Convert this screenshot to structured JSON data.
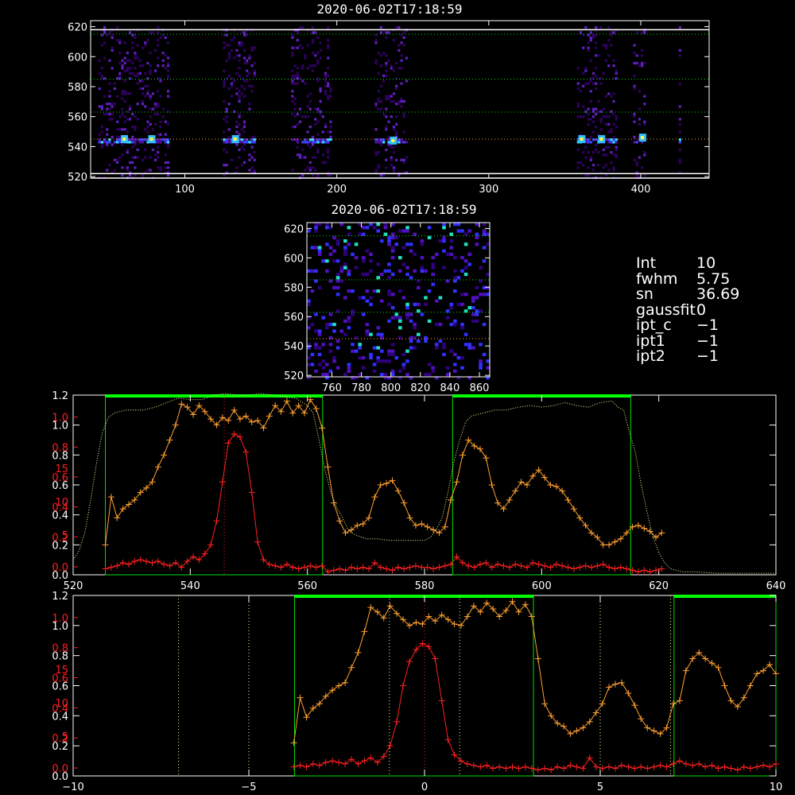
{
  "titles": {
    "top": "2020-06-02T17:18:59",
    "middle": "2020-06-02T17:18:59"
  },
  "fit_info": [
    {
      "key": "Int",
      "value": "10"
    },
    {
      "key": "fwhm",
      "value": "5.75"
    },
    {
      "key": "sn",
      "value": "36.69"
    },
    {
      "key": "gaussfit",
      "value": "0"
    },
    {
      "key": "ipt_c",
      "value": "−1"
    },
    {
      "key": "ipt1",
      "value": "−1"
    },
    {
      "key": "ipt2",
      "value": "−1"
    }
  ],
  "colors": {
    "background": "#000000",
    "orange": "#ffa030",
    "red": "#ff2020",
    "green": "#00e000",
    "window_bar": "#00ff00",
    "dotted": "#ffffa0"
  },
  "chart_data": [
    {
      "type": "heatmap",
      "title": "2020-06-02T17:18:59",
      "xlim": [
        38,
        445
      ],
      "ylim": [
        519,
        624
      ],
      "xticks": [
        "100",
        "200",
        "300",
        "400"
      ],
      "yticks": [
        "520",
        "540",
        "560",
        "580",
        "600",
        "620"
      ],
      "bright_columns": [
        [
          43,
          90
        ],
        [
          125,
          148
        ],
        [
          170,
          198
        ],
        [
          225,
          247
        ],
        [
          358,
          386
        ],
        [
          395,
          405
        ],
        [
          425,
          428
        ]
      ],
      "hot_row": 545,
      "hlines": [
        519,
        522,
        545,
        563,
        585,
        615,
        618
      ]
    },
    {
      "type": "heatmap",
      "title": "2020-06-02T17:18:59",
      "xlim": [
        743,
        867
      ],
      "ylim": [
        519,
        624
      ],
      "xticks": [
        "760",
        "780",
        "800",
        "820",
        "840",
        "860"
      ],
      "yticks": [
        "520",
        "540",
        "560",
        "580",
        "600",
        "620"
      ],
      "hlines": [
        545,
        563,
        585,
        615
      ]
    },
    {
      "type": "line",
      "xlim": [
        520,
        640
      ],
      "ylim": [
        0,
        1.2
      ],
      "xticks": [
        "520",
        "540",
        "560",
        "580",
        "600",
        "620",
        "640"
      ],
      "yticks_white": [
        "0.0",
        "0.2",
        "0.4",
        "0.6",
        "0.8",
        "1.0",
        "1.2"
      ],
      "yticks_red": [
        "0.0",
        "0.2",
        "0.4",
        "0.6",
        "0.8",
        "1.0",
        "1.2"
      ],
      "red_extra_ticks": [
        "5",
        "10",
        "15"
      ],
      "windows": [
        [
          525.5,
          562.6
        ],
        [
          584.8,
          615.2
        ]
      ],
      "center_line": 545.8,
      "series": [
        {
          "color": "orange",
          "x": [
            525.5,
            526.5,
            527.5,
            528.5,
            529.5,
            530.5,
            531.5,
            532.5,
            533.5,
            534.5,
            535.5,
            536.5,
            537.5,
            538.5,
            539.5,
            540.5,
            541.5,
            542.5,
            543.5,
            544.5,
            545.5,
            546.5,
            547.5,
            548.5,
            549.5,
            550.5,
            551.5,
            552.5,
            553.5,
            554.5,
            555.5,
            556.5,
            557.5,
            558.5,
            559.5,
            560.5,
            561.5,
            562.5,
            563.5,
            564.5,
            565.5,
            566.5,
            567.5,
            568.5,
            569.5,
            570.5,
            571.5,
            572.5,
            573.5,
            574.5,
            575.5,
            576.5,
            577.5,
            578.5,
            579.5,
            580.5,
            581.5,
            582.5,
            583.5,
            584.5,
            585.5,
            586.5,
            587.5,
            588.5,
            589.5,
            590.5,
            591.5,
            592.5,
            593.5,
            594.5,
            595.5,
            596.5,
            597.5,
            598.5,
            599.5,
            600.5,
            601.5,
            602.5,
            603.5,
            604.5,
            605.5,
            606.5,
            607.5,
            608.5,
            609.5,
            610.5,
            611.5,
            612.5,
            613.5,
            614.5,
            615.5,
            616.5,
            617.5,
            618.5,
            619.5,
            620.5
          ],
          "y": [
            0.2,
            0.52,
            0.38,
            0.44,
            0.47,
            0.5,
            0.55,
            0.58,
            0.62,
            0.72,
            0.8,
            0.9,
            1.0,
            1.14,
            1.12,
            1.07,
            1.13,
            1.09,
            1.04,
            1.0,
            1.05,
            1.03,
            1.1,
            1.04,
            1.06,
            1.02,
            1.03,
            0.98,
            1.06,
            1.13,
            1.09,
            1.16,
            1.08,
            1.13,
            1.08,
            1.17,
            1.11,
            0.98,
            0.72,
            0.48,
            0.36,
            0.28,
            0.3,
            0.33,
            0.34,
            0.38,
            0.52,
            0.6,
            0.61,
            0.63,
            0.56,
            0.48,
            0.38,
            0.33,
            0.34,
            0.32,
            0.3,
            0.28,
            0.32,
            0.5,
            0.62,
            0.8,
            0.9,
            0.86,
            0.84,
            0.78,
            0.6,
            0.48,
            0.44,
            0.5,
            0.56,
            0.62,
            0.6,
            0.66,
            0.7,
            0.65,
            0.6,
            0.59,
            0.56,
            0.5,
            0.44,
            0.38,
            0.33,
            0.28,
            0.25,
            0.2,
            0.2,
            0.22,
            0.24,
            0.28,
            0.32,
            0.33,
            0.31,
            0.29,
            0.25,
            0.28
          ]
        },
        {
          "color": "red",
          "x": [
            525.5,
            526.5,
            527.5,
            528.5,
            529.5,
            530.5,
            531.5,
            532.5,
            533.5,
            534.5,
            535.5,
            536.5,
            537.5,
            538.5,
            539.5,
            540.5,
            541.5,
            542.5,
            543.5,
            544.5,
            545.5,
            546.5,
            547.5,
            548.5,
            549.5,
            550.5,
            551.5,
            552.5,
            553.5,
            554.5,
            555.5,
            556.5,
            557.5,
            558.5,
            559.5,
            560.5,
            561.5,
            562.5,
            563.5,
            564.5,
            565.5,
            566.5,
            567.5,
            568.5,
            569.5,
            570.5,
            571.5,
            572.5,
            573.5,
            574.5,
            575.5,
            576.5,
            577.5,
            578.5,
            579.5,
            580.5,
            581.5,
            582.5,
            583.5,
            584.5,
            585.5,
            586.5,
            587.5,
            588.5,
            589.5,
            590.5,
            591.5,
            592.5,
            593.5,
            594.5,
            595.5,
            596.5,
            597.5,
            598.5,
            599.5,
            600.5,
            601.5,
            602.5,
            603.5,
            604.5,
            605.5,
            606.5,
            607.5,
            608.5,
            609.5,
            610.5,
            611.5,
            612.5,
            613.5,
            614.5,
            615.5,
            616.5,
            617.5,
            618.5,
            619.5,
            620.5
          ],
          "y": [
            0.04,
            0.05,
            0.06,
            0.08,
            0.07,
            0.09,
            0.1,
            0.09,
            0.08,
            0.09,
            0.07,
            0.06,
            0.08,
            0.05,
            0.09,
            0.12,
            0.1,
            0.14,
            0.2,
            0.36,
            0.62,
            0.88,
            0.94,
            0.92,
            0.82,
            0.55,
            0.22,
            0.1,
            0.07,
            0.06,
            0.05,
            0.07,
            0.05,
            0.04,
            0.05,
            0.06,
            0.05,
            0.06,
            0.02,
            0.03,
            0.04,
            0.03,
            0.05,
            0.04,
            0.05,
            0.04,
            0.08,
            0.05,
            0.04,
            0.03,
            0.05,
            0.04,
            0.05,
            0.06,
            0.05,
            0.05,
            0.04,
            0.05,
            0.06,
            0.07,
            0.12,
            0.08,
            0.06,
            0.05,
            0.07,
            0.08,
            0.05,
            0.07,
            0.06,
            0.05,
            0.07,
            0.06,
            0.05,
            0.08,
            0.07,
            0.06,
            0.05,
            0.07,
            0.06,
            0.05,
            0.04,
            0.05,
            0.06,
            0.05,
            0.06,
            0.07,
            0.05,
            0.04,
            0.05,
            0.04,
            0.03,
            0.02,
            0.03,
            0.02,
            0.03,
            0.04
          ]
        },
        {
          "color": "dotted",
          "x": [
            520,
            521,
            522,
            523,
            524,
            525,
            526,
            527,
            528,
            529,
            530,
            532,
            534,
            536,
            538,
            540,
            542,
            544,
            546,
            548,
            550,
            552,
            554,
            556,
            558,
            560,
            561,
            562,
            563,
            564,
            565,
            566,
            567,
            568,
            570,
            572,
            574,
            576,
            578,
            580,
            581,
            582,
            583,
            584,
            585,
            586,
            587,
            588,
            590,
            592,
            594,
            596,
            598,
            600,
            602,
            604,
            606,
            608,
            610,
            612,
            613,
            614,
            615,
            616,
            617,
            618,
            619,
            620,
            621,
            622,
            623,
            624,
            626,
            630,
            635,
            640
          ],
          "y": [
            0.1,
            0.16,
            0.28,
            0.5,
            0.75,
            0.95,
            1.05,
            1.08,
            1.09,
            1.1,
            1.1,
            1.1,
            1.12,
            1.15,
            1.18,
            1.17,
            1.17,
            1.2,
            1.21,
            1.2,
            1.2,
            1.21,
            1.2,
            1.19,
            1.18,
            1.13,
            1.08,
            0.9,
            0.7,
            0.55,
            0.45,
            0.38,
            0.3,
            0.27,
            0.24,
            0.24,
            0.23,
            0.23,
            0.23,
            0.23,
            0.25,
            0.3,
            0.38,
            0.55,
            0.75,
            0.9,
            1.02,
            1.06,
            1.08,
            1.1,
            1.1,
            1.12,
            1.13,
            1.12,
            1.13,
            1.15,
            1.13,
            1.12,
            1.15,
            1.16,
            1.12,
            1.1,
            0.95,
            0.82,
            0.6,
            0.42,
            0.25,
            0.15,
            0.08,
            0.04,
            0.03,
            0.02,
            0.02,
            0.01,
            0.01,
            0.01
          ]
        }
      ]
    },
    {
      "type": "line",
      "xlim": [
        -10,
        10
      ],
      "ylim": [
        0,
        1.2
      ],
      "xticks": [
        "−10",
        "−5",
        "0",
        "5",
        "10"
      ],
      "yticks_white": [
        "0.0",
        "0.2",
        "0.4",
        "0.6",
        "0.8",
        "1.0",
        "1.2"
      ],
      "yticks_red": [
        "0.0",
        "0.2",
        "0.4",
        "0.6",
        "0.8",
        "1.0",
        "1.2"
      ],
      "red_extra_ticks": [
        "5",
        "10",
        "15"
      ],
      "windows": [
        [
          -3.7,
          3.1
        ],
        [
          7.1,
          10.0
        ]
      ],
      "center_line": 0,
      "vlines": [
        -7,
        -5,
        -1,
        1,
        5,
        7
      ],
      "series": [
        {
          "color": "orange",
          "x": [
            -3.72,
            -3.54,
            -3.36,
            -3.17,
            -2.99,
            -2.81,
            -2.62,
            -2.44,
            -2.26,
            -2.08,
            -1.89,
            -1.71,
            -1.53,
            -1.34,
            -1.16,
            -0.98,
            -0.79,
            -0.61,
            -0.43,
            -0.24,
            -0.06,
            0.12,
            0.3,
            0.49,
            0.67,
            0.85,
            1.04,
            1.22,
            1.4,
            1.59,
            1.77,
            1.95,
            2.13,
            2.32,
            2.5,
            2.68,
            2.87,
            3.05,
            3.23,
            3.42,
            3.6,
            3.78,
            3.96,
            4.15,
            4.33,
            4.51,
            4.7,
            4.88,
            5.06,
            5.25,
            5.43,
            5.61,
            5.8,
            5.98,
            6.16,
            6.34,
            6.53,
            6.71,
            6.89,
            7.08,
            7.26,
            7.44,
            7.63,
            7.81,
            7.99,
            8.18,
            8.36,
            8.54,
            8.72,
            8.91,
            9.09,
            9.27,
            9.46,
            9.64,
            9.82,
            10.0
          ],
          "y": [
            0.22,
            0.52,
            0.39,
            0.45,
            0.48,
            0.53,
            0.57,
            0.6,
            0.62,
            0.72,
            0.82,
            0.96,
            1.12,
            1.09,
            1.05,
            1.13,
            1.08,
            1.04,
            1.0,
            1.02,
            1.01,
            1.06,
            1.03,
            1.07,
            1.04,
            1.01,
            1.0,
            1.06,
            1.13,
            1.09,
            1.15,
            1.11,
            1.06,
            1.1,
            1.16,
            1.09,
            1.14,
            1.06,
            0.78,
            0.48,
            0.4,
            0.35,
            0.33,
            0.28,
            0.3,
            0.32,
            0.36,
            0.42,
            0.48,
            0.59,
            0.61,
            0.62,
            0.55,
            0.47,
            0.38,
            0.32,
            0.3,
            0.28,
            0.32,
            0.48,
            0.5,
            0.7,
            0.78,
            0.82,
            0.78,
            0.75,
            0.72,
            0.6,
            0.5,
            0.46,
            0.52,
            0.6,
            0.68,
            0.7,
            0.74,
            0.68
          ]
        },
        {
          "color": "red",
          "x": [
            -3.72,
            -3.54,
            -3.36,
            -3.17,
            -2.99,
            -2.81,
            -2.62,
            -2.44,
            -2.26,
            -2.08,
            -1.89,
            -1.71,
            -1.53,
            -1.34,
            -1.16,
            -0.98,
            -0.79,
            -0.61,
            -0.43,
            -0.24,
            -0.06,
            0.12,
            0.3,
            0.49,
            0.67,
            0.85,
            1.04,
            1.22,
            1.4,
            1.59,
            1.77,
            1.95,
            2.13,
            2.32,
            2.5,
            2.68,
            2.87,
            3.05,
            3.23,
            3.42,
            3.6,
            3.78,
            3.96,
            4.15,
            4.33,
            4.51,
            4.7,
            4.88,
            5.06,
            5.25,
            5.43,
            5.61,
            5.8,
            5.98,
            6.16,
            6.34,
            6.53,
            6.71,
            6.89,
            7.08,
            7.26,
            7.44,
            7.63,
            7.81,
            7.99,
            8.18,
            8.36,
            8.54,
            8.72,
            8.91,
            9.09,
            9.27,
            9.46,
            9.64,
            9.82,
            10.0
          ],
          "y": [
            0.06,
            0.07,
            0.06,
            0.08,
            0.07,
            0.09,
            0.1,
            0.09,
            0.08,
            0.11,
            0.08,
            0.1,
            0.12,
            0.09,
            0.13,
            0.2,
            0.36,
            0.6,
            0.76,
            0.84,
            0.88,
            0.86,
            0.78,
            0.5,
            0.24,
            0.14,
            0.1,
            0.08,
            0.07,
            0.06,
            0.07,
            0.05,
            0.06,
            0.05,
            0.06,
            0.05,
            0.06,
            0.05,
            0.04,
            0.05,
            0.04,
            0.06,
            0.05,
            0.07,
            0.06,
            0.05,
            0.12,
            0.06,
            0.05,
            0.06,
            0.05,
            0.07,
            0.06,
            0.05,
            0.06,
            0.05,
            0.06,
            0.07,
            0.06,
            0.08,
            0.1,
            0.08,
            0.07,
            0.08,
            0.06,
            0.07,
            0.05,
            0.06,
            0.05,
            0.04,
            0.06,
            0.05,
            0.06,
            0.07,
            0.06,
            0.08
          ]
        }
      ]
    }
  ]
}
